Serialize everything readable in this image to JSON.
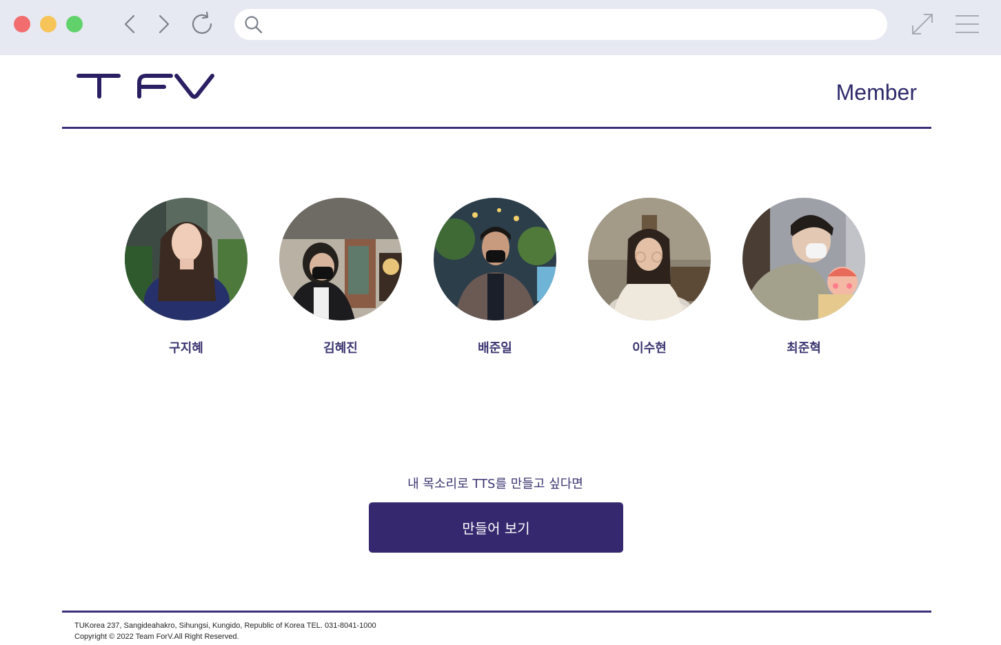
{
  "browser": {
    "address_value": "",
    "icons": [
      "close-light",
      "minimize-light",
      "maximize-light",
      "back-icon",
      "forward-icon",
      "reload-icon",
      "search-icon",
      "expand-icon",
      "menu-icon"
    ]
  },
  "header": {
    "logo_text": "TFV",
    "nav_member": "Member"
  },
  "members": [
    {
      "name": "구지혜"
    },
    {
      "name": "김혜진"
    },
    {
      "name": "배준일"
    },
    {
      "name": "이수현"
    },
    {
      "name": "최준혁"
    }
  ],
  "cta": {
    "prompt": "내 목소리로 TTS를 만들고 싶다면",
    "button_label": "만들어 보기"
  },
  "footer": {
    "address": "TUKorea 237, Sangideahakro, Sihungsi, Kungido, Republic of Korea TEL. 031-8041-1000",
    "copyright": "Copyright © 2022 Team ForV.All Right Reserved."
  },
  "colors": {
    "brand": "#35286e",
    "text": "#3a3470",
    "chrome": "#e6e9f1"
  }
}
